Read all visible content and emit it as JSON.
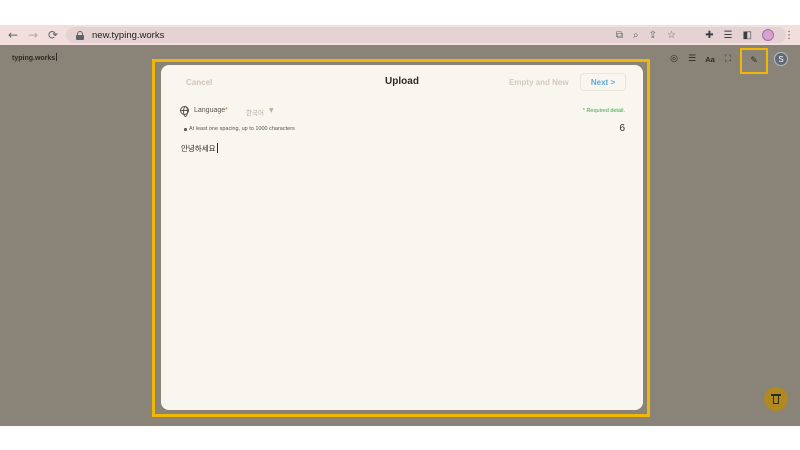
{
  "browser": {
    "url": "new.typing.works",
    "icons": {
      "back": "arrow-left-icon",
      "forward": "arrow-right-icon",
      "reload": "reload-icon",
      "translate": "translate-icon",
      "zoom": "zoom-icon",
      "share": "share-icon",
      "bookmark": "star-icon",
      "extensions": "puzzle-icon",
      "reading_list": "reading-list-icon",
      "side_panel": "side-panel-icon",
      "profile": "profile-avatar",
      "menu": "kebab-menu-icon"
    }
  },
  "site": {
    "logo": "typing.works",
    "toolbar": {
      "aa_label": "Aa",
      "avatar_letter": "S",
      "icons": [
        "target-icon",
        "list-icon",
        "font-size-icon",
        "fullscreen-icon",
        "pencil-icon",
        "user-avatar"
      ]
    }
  },
  "modal": {
    "title": "Upload",
    "cancel_label": "Cancel",
    "empty_new_label": "Empty and New",
    "next_label": "Next  >",
    "language_label": "Language",
    "language_required_mark": "*",
    "language_value": "한국어",
    "required_note": "* Required detail.",
    "hint": "At least one spacing, up to 1000 characters",
    "char_count": "6",
    "text_content": "안녕하세요"
  },
  "colors": {
    "page_background": "#8a8478",
    "modal_background": "#f8f6ef",
    "highlight": "#f2b705",
    "next_blue": "#5aa9d6",
    "required_green": "#3aa64c",
    "required_mark_orange": "#e06c1f",
    "trash_button": "#b08920"
  }
}
